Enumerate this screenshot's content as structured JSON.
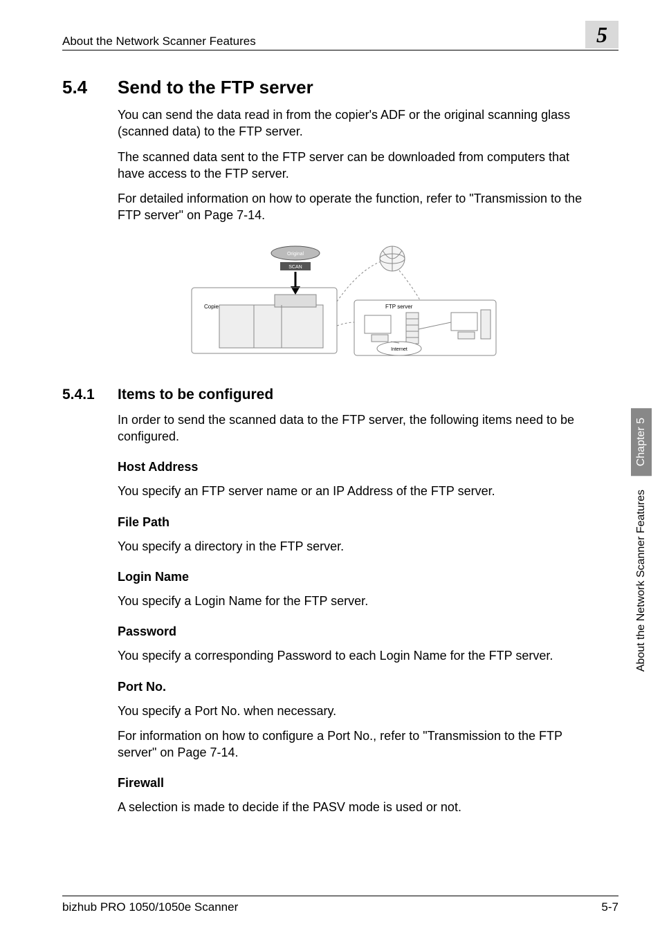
{
  "header": {
    "section_title": "About the Network Scanner Features",
    "chapter_number": "5"
  },
  "section": {
    "number": "5.4",
    "title": "Send to the FTP server",
    "paragraphs": [
      "You can send the data read in from the copier's ADF or the original scanning glass (scanned data) to the FTP server.",
      "The scanned data sent to the FTP server can be downloaded from computers that have access to the FTP server.",
      "For detailed information on how to operate the function, refer to \"Transmission to the FTP server\" on Page 7-14."
    ]
  },
  "diagram": {
    "labels": {
      "original": "Original",
      "scan": "SCAN",
      "copier": "Copier",
      "ftp_server": "FTP server",
      "internet": "Internet"
    }
  },
  "subsection": {
    "number": "5.4.1",
    "title": "Items to be configured",
    "intro": "In order to send the scanned data to the FTP server, the following items need to be configured.",
    "items": [
      {
        "heading": "Host Address",
        "text": "You specify an FTP server name or an IP Address of the FTP server."
      },
      {
        "heading": "File Path",
        "text": "You specify a directory in the FTP server."
      },
      {
        "heading": "Login Name",
        "text": "You specify a Login Name for the FTP server."
      },
      {
        "heading": "Password",
        "text": "You specify a corresponding Password to each Login Name for the FTP server."
      },
      {
        "heading": "Port No.",
        "text": "You specify a Port No. when necessary.",
        "text2": "For information on how to configure a Port No., refer to \"Transmission to the FTP server\" on Page 7-14."
      },
      {
        "heading": "Firewall",
        "text": "A selection is made to decide if the PASV mode is used or not."
      }
    ]
  },
  "side_tab": {
    "chapter": "Chapter 5",
    "label": "About the Network Scanner Features"
  },
  "footer": {
    "left": "bizhub PRO 1050/1050e Scanner",
    "right": "5-7"
  }
}
